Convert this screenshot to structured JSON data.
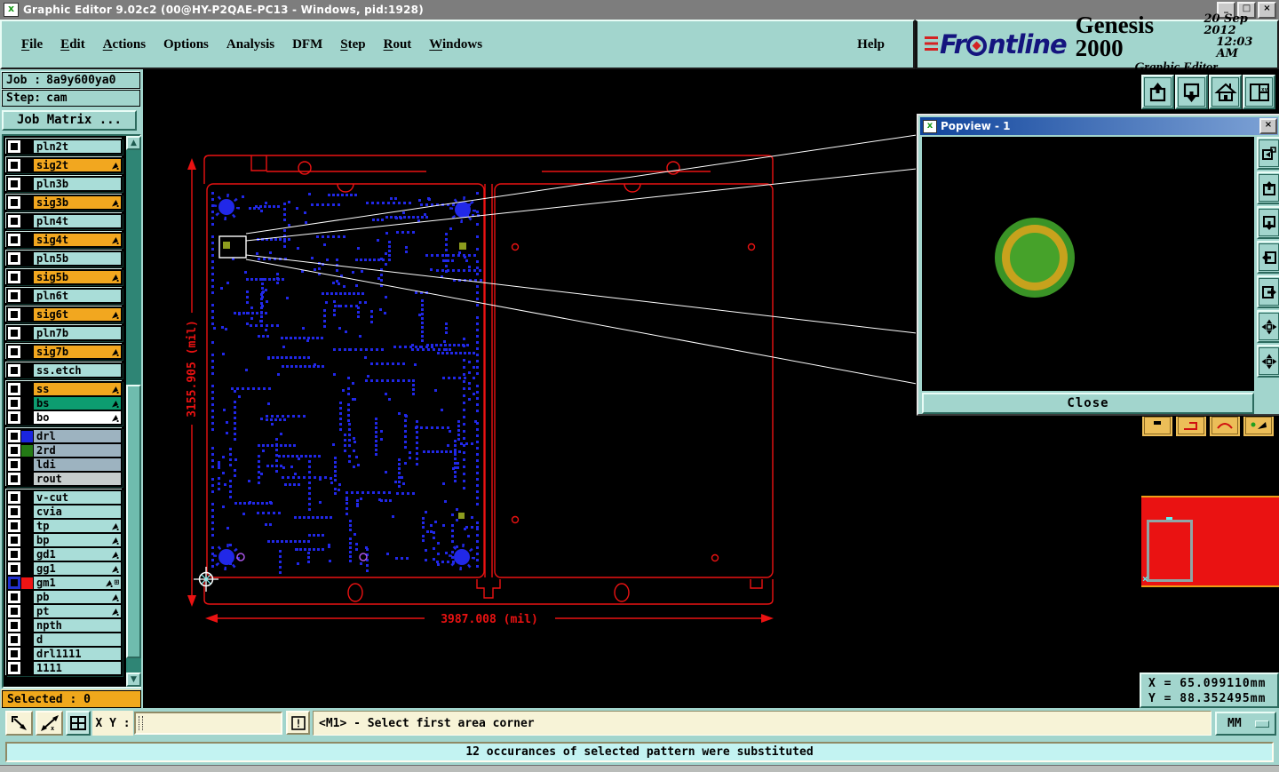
{
  "window": {
    "title": "Graphic Editor 9.02c2 (00@HY-P2QAE-PC13 - Windows, pid:1928)",
    "controls": [
      "minimize",
      "maximize",
      "close"
    ]
  },
  "menu": {
    "items": [
      {
        "label": "File",
        "u": 0
      },
      {
        "label": "Edit",
        "u": 0
      },
      {
        "label": "Actions",
        "u": 0
      },
      {
        "label": "Options",
        "u": -1
      },
      {
        "label": "Analysis",
        "u": -1
      },
      {
        "label": "DFM",
        "u": -1
      },
      {
        "label": "Step",
        "u": 0
      },
      {
        "label": "Rout",
        "u": 0
      },
      {
        "label": "Windows",
        "u": 0
      }
    ],
    "help": {
      "label": "Help",
      "u": -1
    }
  },
  "brand": {
    "logo_fr": "Fr",
    "logo_rest": "ntline",
    "product": "Genesis 2000",
    "date": "20 Sep 2012",
    "time": "12:03 AM",
    "subtitle": "Graphic Editor"
  },
  "job": {
    "job_label": "Job :",
    "job_value": "8a9y600ya0",
    "step_label": "Step:",
    "step_value": "cam",
    "matrix_button": "Job Matrix ...",
    "selected_label": "Selected : 0"
  },
  "layers": {
    "groups": [
      {
        "solo": true,
        "items": [
          {
            "name": "pln2t",
            "bg": "teal"
          },
          {
            "name": "sig2t",
            "bg": "orange",
            "paw": true
          },
          {
            "name": "pln3b",
            "bg": "teal"
          },
          {
            "name": "sig3b",
            "bg": "orange",
            "paw": true
          },
          {
            "name": "pln4t",
            "bg": "teal"
          },
          {
            "name": "sig4t",
            "bg": "orange",
            "paw": true
          },
          {
            "name": "pln5b",
            "bg": "teal"
          },
          {
            "name": "sig5b",
            "bg": "orange",
            "paw": true
          },
          {
            "name": "pln6t",
            "bg": "teal"
          },
          {
            "name": "sig6t",
            "bg": "orange",
            "paw": true
          },
          {
            "name": "pln7b",
            "bg": "teal"
          },
          {
            "name": "sig7b",
            "bg": "orange",
            "paw": true
          },
          {
            "name": "ss.etch",
            "bg": "teal"
          }
        ]
      },
      {
        "items": [
          {
            "name": "ss",
            "bg": "orange",
            "paw": true
          },
          {
            "name": "bs",
            "bg": "green",
            "paw": true
          },
          {
            "name": "bo",
            "bg": "white",
            "paw": true
          }
        ]
      },
      {
        "items": [
          {
            "name": "drl",
            "bg": "grayblue",
            "swatch": "#1a25e0"
          },
          {
            "name": "2rd",
            "bg": "grayblue",
            "swatch": "#237a15"
          },
          {
            "name": "ldi",
            "bg": "grayblue"
          },
          {
            "name": "rout",
            "bg": "gray"
          }
        ]
      },
      {
        "items": [
          {
            "name": "v-cut",
            "bg": "teal"
          },
          {
            "name": "cvia",
            "bg": "teal"
          },
          {
            "name": "tp",
            "bg": "teal",
            "paw": true
          },
          {
            "name": "bp",
            "bg": "teal",
            "paw": true
          },
          {
            "name": "gd1",
            "bg": "teal",
            "paw": true
          },
          {
            "name": "gg1",
            "bg": "teal",
            "paw": true
          },
          {
            "name": "gm1",
            "bg": "teal",
            "paw": true,
            "grid": true,
            "swatch": "#ee1414",
            "active": true
          },
          {
            "name": "pb",
            "bg": "teal",
            "paw": true
          },
          {
            "name": "pt",
            "bg": "teal",
            "paw": true
          },
          {
            "name": "npth",
            "bg": "teal"
          },
          {
            "name": "d",
            "bg": "teal"
          },
          {
            "name": "drl1111",
            "bg": "teal"
          },
          {
            "name": "1111",
            "bg": "teal"
          }
        ]
      }
    ]
  },
  "canvas": {
    "height_dim": "3155.905 (mil)",
    "width_dim": "3987.008 (mil)"
  },
  "toolbar_right": {
    "icons": [
      "export-up",
      "import-down",
      "home",
      "split-window-xy"
    ]
  },
  "popview": {
    "title": "Popview - 1",
    "close_label": "Close",
    "icons": [
      "copy-view",
      "view-up",
      "view-down",
      "view-left",
      "view-right",
      "zoom-fit",
      "center-view"
    ]
  },
  "pop_tools": {
    "icons": [
      "pop-tool-1",
      "pop-tool-2",
      "pop-tool-3",
      "pop-tool-4"
    ]
  },
  "bottom_tools": {
    "icons": [
      "area-zoom",
      "measure",
      "tile-windows"
    ],
    "xy_label": "X Y :",
    "xy_value": "",
    "alert_icon": "exclamation",
    "prompt": "<M1> - Select first area corner",
    "units": "MM"
  },
  "coords": {
    "x": "X = 65.099110mm",
    "y": "Y = 88.352495mm"
  },
  "status": {
    "message": "12 occurances of selected pattern were substituted"
  },
  "colors": {
    "chrome_teal": "#a2d5cd",
    "layer_orange": "#f2a71f",
    "board_red": "#ea1212",
    "pad_blue": "#2128e8",
    "pad_olive": "#8d9c1e",
    "popview_ring_green": "#3a9326",
    "popview_ring_yellow": "#c7a21d",
    "status_cyan": "#c3f3f2"
  }
}
